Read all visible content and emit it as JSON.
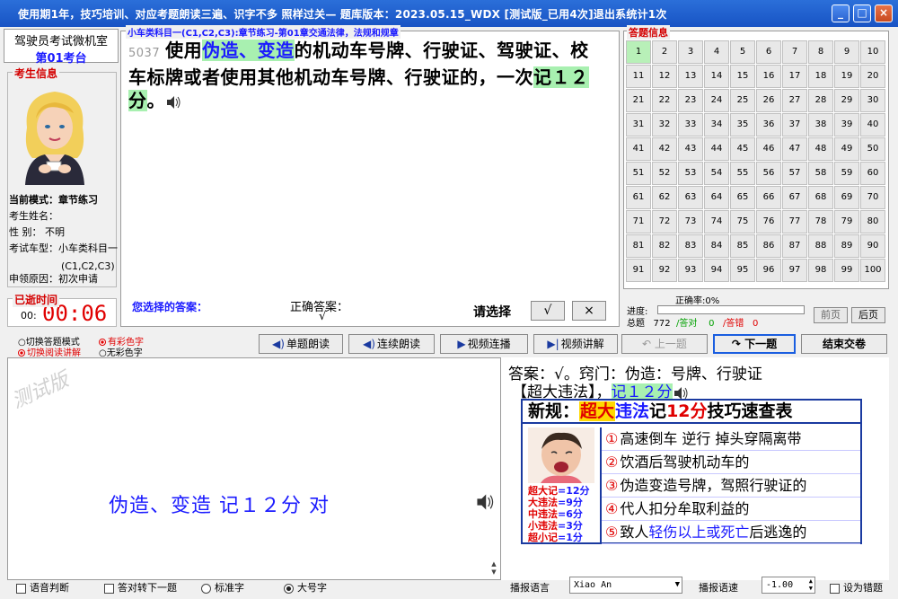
{
  "window": {
    "title": "使用期1年，技巧培训、对应考题朗读三遍、识字不多 照样过关—  题库版本：2023.05.15_WDX [测试版_已用4次]退出系统计1次",
    "minimize": "_",
    "maximize": "□",
    "close": "×"
  },
  "left": {
    "header_line1": "驾驶员考试微机室",
    "header_line2": "第01考台",
    "info_label": "考生信息",
    "mode": "当前模式：章节练习",
    "name": "考生姓名：",
    "gender": "性    别： 不明",
    "car_type": "考试车型：小车类科目一",
    "car_type2": "(C1,C2,C3)",
    "reason": "申领原因：初次申请",
    "elapsed_label": "已逝时间",
    "elapsed_prefix": "00:",
    "elapsed_value": "00:06"
  },
  "question": {
    "category": "小车类科目一(C1,C2,C3):章节练习-第01章交通法律，法规和规章",
    "number": "5037",
    "text_a": "使用",
    "text_hl": "伪造、变造",
    "text_b": "的机动车号牌、行驶证、驾驶证、校车标牌或者使用其他机动车号牌、行驶证的，一次",
    "text_hl2": "记１２分",
    "text_c": "。",
    "your_answer_label": "您选择的答案：",
    "correct_label": "正确答案：",
    "correct_value": "√",
    "choose_label": "请选择",
    "btn_true": "√",
    "btn_false": "×"
  },
  "grid": {
    "label": "答题信息",
    "current": 1,
    "cells": [
      "1",
      "2",
      "3",
      "4",
      "5",
      "6",
      "7",
      "8",
      "9",
      "10",
      "11",
      "12",
      "13",
      "14",
      "15",
      "16",
      "17",
      "18",
      "19",
      "20",
      "21",
      "22",
      "23",
      "24",
      "25",
      "26",
      "27",
      "28",
      "29",
      "30",
      "31",
      "32",
      "33",
      "34",
      "35",
      "36",
      "37",
      "38",
      "39",
      "40",
      "41",
      "42",
      "43",
      "44",
      "45",
      "46",
      "47",
      "48",
      "49",
      "50",
      "51",
      "52",
      "53",
      "54",
      "55",
      "56",
      "57",
      "58",
      "59",
      "60",
      "61",
      "62",
      "63",
      "64",
      "65",
      "66",
      "67",
      "68",
      "69",
      "70",
      "71",
      "72",
      "73",
      "74",
      "75",
      "76",
      "77",
      "78",
      "79",
      "80",
      "81",
      "82",
      "83",
      "84",
      "85",
      "86",
      "87",
      "88",
      "89",
      "90",
      "91",
      "92",
      "93",
      "94",
      "95",
      "96",
      "97",
      "98",
      "99",
      "100"
    ]
  },
  "stats": {
    "rate": "正确率:0%",
    "progress_label": "进度:",
    "progress": 0.0,
    "total_label": "总题",
    "total": "772",
    "correct_label": "/答对",
    "correct": "0",
    "wrong_label": "/答错",
    "wrong": "0",
    "prev_page": "前页",
    "next_page": "后页"
  },
  "toolbar": {
    "opt1": "○切换答题模式",
    "opt2": "切换阅读讲解",
    "opt3": "有彩色字",
    "opt4": "○无彩色字",
    "single_read": "单题朗读",
    "continuous_read": "连续朗读",
    "video_play": "视频连播",
    "video_explain": "视频讲解",
    "prev": "上一题",
    "next": "下一题",
    "finish": "结束交卷"
  },
  "explain": {
    "watermark": "测试版",
    "big_answer": "伪造、变造  记１２分  对",
    "answer_line": "答案：√。窍门：伪造：号牌、行驶证",
    "answer_line2a": "【超大违法】，",
    "answer_line2b": "记１２分",
    "rules_title_a": "新规：",
    "rules_title_b": "超大",
    "rules_title_c": "违法",
    "rules_title_d": "记",
    "rules_title_e": "12分",
    "rules_title_f": "技巧速查表",
    "baby_lines": [
      {
        "a": "超大记",
        "b": "=12分"
      },
      {
        "a": "大违法",
        "b": "=9分"
      },
      {
        "a": "中违法",
        "b": "=6分"
      },
      {
        "a": "小违法",
        "b": "=3分"
      },
      {
        "a": "超小记",
        "b": "=1分"
      }
    ],
    "rules": [
      {
        "n": "①",
        "t": "高速倒车  逆行  掉头穿隔离带",
        "b": ""
      },
      {
        "n": "②",
        "t": "饮酒后驾驶机动车的",
        "b": ""
      },
      {
        "n": "③",
        "t": "伪造变造号牌，驾照行驶证的",
        "b": ""
      },
      {
        "n": "④",
        "t": "代人扣分牟取利益的",
        "b": ""
      },
      {
        "n": "⑤",
        "t": "致人",
        "b": "轻伤以上或死亡",
        "t2": "后逃逸的"
      }
    ]
  },
  "footer": {
    "voice_judge": "语音判断",
    "auto_next": "答对转下一题",
    "std_font": "标准字",
    "big_font": "大号字",
    "voice_lang_label": "播报语言",
    "voice_lang": "Xiao An",
    "speed_label": "播报语速",
    "speed": "-1.00",
    "set_wrong": "设为错题"
  }
}
